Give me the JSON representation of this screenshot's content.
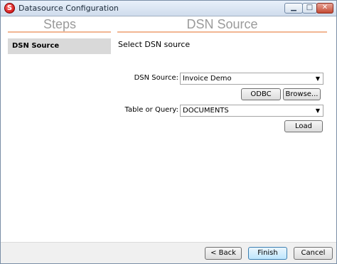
{
  "window": {
    "title": "Datasource Configuration",
    "app_icon_letter": "S",
    "minimize_glyph": "▁",
    "maximize_glyph": "□",
    "close_glyph": "✕"
  },
  "steps": {
    "header": "Steps",
    "items": [
      {
        "label": "DSN Source",
        "selected": true
      }
    ]
  },
  "main": {
    "header": "DSN Source",
    "subtitle": "Select DSN source",
    "dsn_source": {
      "label": "DSN Source:",
      "value": "Invoice Demo"
    },
    "odbc_label": "ODBC",
    "browse_label": "Browse...",
    "table_query": {
      "label": "Table or Query:",
      "value": "DOCUMENTS"
    },
    "load_label": "Load"
  },
  "footer": {
    "back_label": "< Back",
    "finish_label": "Finish",
    "cancel_label": "Cancel"
  },
  "colors": {
    "header_rule": "#f2b693",
    "selected_step_bg": "#d9d9d9",
    "header_text": "#9a9a9a"
  },
  "icons": {
    "dropdown": "chevron-down-icon",
    "app": "app-logo-icon"
  }
}
